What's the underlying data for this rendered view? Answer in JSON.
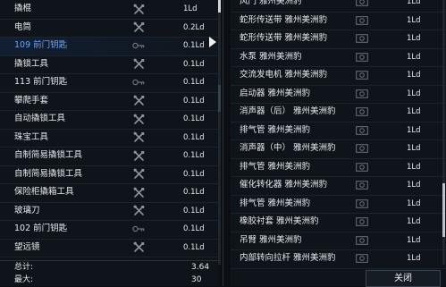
{
  "left_items": [
    {
      "name": "撬棍",
      "icon": "tools-icon",
      "value": "1Ld"
    },
    {
      "name": "电筒",
      "icon": "tools-icon",
      "value": "0.2Ld"
    },
    {
      "name": "109 前门钥匙",
      "icon": "key-icon",
      "value": "0.1Ld",
      "selected": true
    },
    {
      "name": "撬锁工具",
      "icon": "tools-icon",
      "value": "0.1Ld"
    },
    {
      "name": "113 前门钥匙",
      "icon": "key-icon",
      "value": "0.1Ld"
    },
    {
      "name": "攀爬手套",
      "icon": "tools-icon",
      "value": "0.1Ld"
    },
    {
      "name": "自动撬锁工具",
      "icon": "tools-icon",
      "value": "0.1Ld"
    },
    {
      "name": "珠宝工具",
      "icon": "tools-icon",
      "value": "0.1Ld"
    },
    {
      "name": "自制简易撬锁工具",
      "icon": "tools-icon",
      "value": "0.1Ld"
    },
    {
      "name": "自制简易撬锁工具",
      "icon": "tools-icon",
      "value": "0.1Ld"
    },
    {
      "name": "保险柜撬箱工具",
      "icon": "tools-icon",
      "value": "0.1Ld"
    },
    {
      "name": "玻璃刀",
      "icon": "tools-icon",
      "value": "0.1Ld"
    },
    {
      "name": "102 前门钥匙",
      "icon": "key-icon",
      "value": "0.1Ld"
    },
    {
      "name": "望远镜",
      "icon": "tools-icon",
      "value": "0.1Ld"
    }
  ],
  "right_items": [
    {
      "name": "风门 雅州美洲豹",
      "icon": "camera-icon",
      "value": "1Ld"
    },
    {
      "name": "蛇形传送带 雅州美洲豹",
      "icon": "camera-icon",
      "value": "1Ld"
    },
    {
      "name": "蛇形传送带 雅州美洲豹",
      "icon": "camera-icon",
      "value": "1Ld"
    },
    {
      "name": "水泵 雅州美洲豹",
      "icon": "camera-icon",
      "value": "1Ld"
    },
    {
      "name": "交流发电机 雅州美洲豹",
      "icon": "camera-icon",
      "value": "1Ld"
    },
    {
      "name": "启动器 雅州美洲豹",
      "icon": "camera-icon",
      "value": "1Ld"
    },
    {
      "name": "消声器（后） 雅州美洲豹",
      "icon": "camera-icon",
      "value": "1Ld"
    },
    {
      "name": "排气管 雅州美洲豹",
      "icon": "camera-icon",
      "value": "1Ld"
    },
    {
      "name": "消声器（中） 雅州美洲豹",
      "icon": "camera-icon",
      "value": "1Ld"
    },
    {
      "name": "排气管 雅州美洲豹",
      "icon": "camera-icon",
      "value": "1Ld"
    },
    {
      "name": "催化转化器 雅州美洲豹",
      "icon": "camera-icon",
      "value": "1Ld"
    },
    {
      "name": "排气管 雅州美洲豹",
      "icon": "camera-icon",
      "value": "1Ld"
    },
    {
      "name": "橡胶衬套 雅州美洲豹",
      "icon": "camera-icon",
      "value": "1Ld"
    },
    {
      "name": "吊臂 雅州美洲豹",
      "icon": "camera-icon",
      "value": "1Ld"
    },
    {
      "name": "内部转向拉杆 雅州美洲豹",
      "icon": "camera-icon",
      "value": "1Ld"
    }
  ],
  "summary": {
    "total_label": "总计:",
    "total_value": "3.64",
    "max_label": "最大:",
    "max_value": "30"
  },
  "close_button": "关闭",
  "colors": {
    "selected_text": "#6aa6ff",
    "background": "#0f141a"
  }
}
